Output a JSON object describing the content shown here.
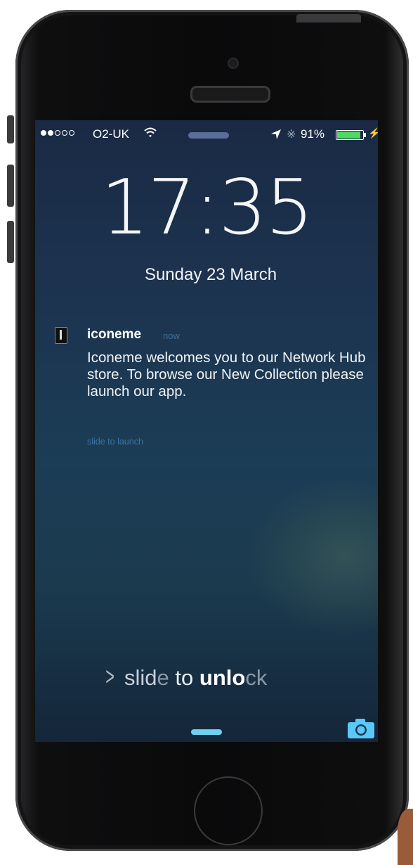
{
  "status_bar": {
    "signal_bars_filled": 2,
    "signal_bars_total": 5,
    "carrier": "O2-UK",
    "battery_percent_text": "91%",
    "battery_level": 0.91,
    "battery_color": "#4cd964"
  },
  "lock_screen": {
    "time": "17:35",
    "date": "Sunday 23 March"
  },
  "notification": {
    "app_name": "iconeme",
    "timestamp": "now",
    "body": "Iconeme welcomes you to our Network Hub store.  To browse our New Collection please launch our app.",
    "action_hint": "slide to launch"
  },
  "unlock": {
    "prefix": "slid",
    "middle_faded": "e",
    "middle": " to ",
    "highlight": "unlo",
    "suffix_faded": "ck"
  },
  "icons": {
    "wifi": "wifi-icon",
    "location": "location-arrow-icon",
    "bluetooth": "bluetooth-icon",
    "battery": "battery-icon",
    "charging": "charging-bolt-icon",
    "camera": "camera-icon",
    "chevron": "chevron-right-icon"
  },
  "colors": {
    "accent": "#6dd0f0",
    "camera_icon": "#5ac8fa"
  }
}
